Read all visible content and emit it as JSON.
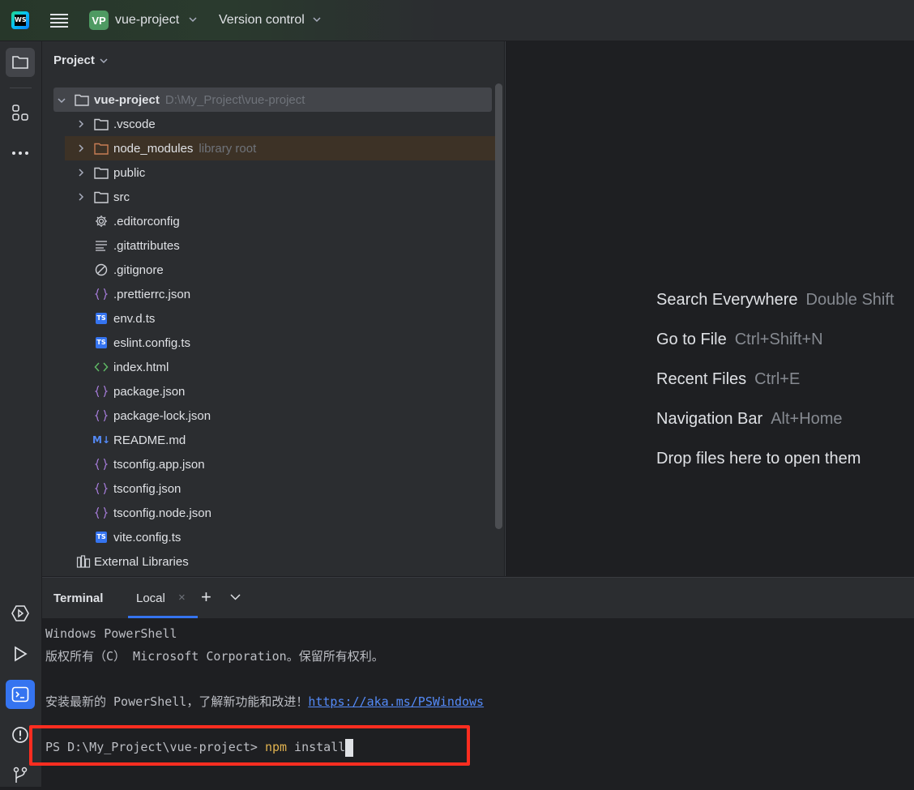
{
  "titlebar": {
    "project_badge": "VP",
    "project_name": "vue-project",
    "version_control": "Version control"
  },
  "project_panel": {
    "title": "Project",
    "tree": [
      {
        "name": "vue-project",
        "hint": "D:\\My_Project\\vue-project",
        "type": "folder",
        "expanded": true
      },
      {
        "name": ".vscode",
        "type": "folder"
      },
      {
        "name": "node_modules",
        "hint": "library root",
        "type": "folder-lib"
      },
      {
        "name": "public",
        "type": "folder"
      },
      {
        "name": "src",
        "type": "folder"
      },
      {
        "name": ".editorconfig",
        "type": "gear"
      },
      {
        "name": ".gitattributes",
        "type": "text"
      },
      {
        "name": ".gitignore",
        "type": "ignore"
      },
      {
        "name": ".prettierrc.json",
        "type": "json"
      },
      {
        "name": "env.d.ts",
        "type": "ts"
      },
      {
        "name": "eslint.config.ts",
        "type": "ts"
      },
      {
        "name": "index.html",
        "type": "html"
      },
      {
        "name": "package.json",
        "type": "json"
      },
      {
        "name": "package-lock.json",
        "type": "json"
      },
      {
        "name": "README.md",
        "type": "md"
      },
      {
        "name": "tsconfig.app.json",
        "type": "json"
      },
      {
        "name": "tsconfig.json",
        "type": "json"
      },
      {
        "name": "tsconfig.node.json",
        "type": "json"
      },
      {
        "name": "vite.config.ts",
        "type": "ts"
      },
      {
        "name": "External Libraries",
        "type": "libraries"
      }
    ],
    "icons": {
      "ts": "TS",
      "md": "M↓"
    }
  },
  "editor_hints": [
    {
      "label": "Search Everywhere",
      "shortcut": "Double Shift"
    },
    {
      "label": "Go to File",
      "shortcut": "Ctrl+Shift+N"
    },
    {
      "label": "Recent Files",
      "shortcut": "Ctrl+E"
    },
    {
      "label": "Navigation Bar",
      "shortcut": "Alt+Home"
    },
    {
      "label": "Drop files here to open them",
      "shortcut": ""
    }
  ],
  "terminal": {
    "title": "Terminal",
    "tab_label": "Local",
    "tab_close": "×",
    "add": "+",
    "lines": {
      "l1": "Windows PowerShell",
      "l2": "版权所有（C） Microsoft Corporation。保留所有权利。",
      "l4_text": "安装最新的 PowerShell，了解新功能和改进！",
      "l4_link": "https://aka.ms/PSWindows",
      "prompt": "PS D:\\My_Project\\vue-project> ",
      "cmd": "npm",
      "arg": " install"
    }
  },
  "colors": {
    "accent": "#3574f0",
    "highlight_box": "#ff2d20",
    "npm": "#e0b24f"
  }
}
